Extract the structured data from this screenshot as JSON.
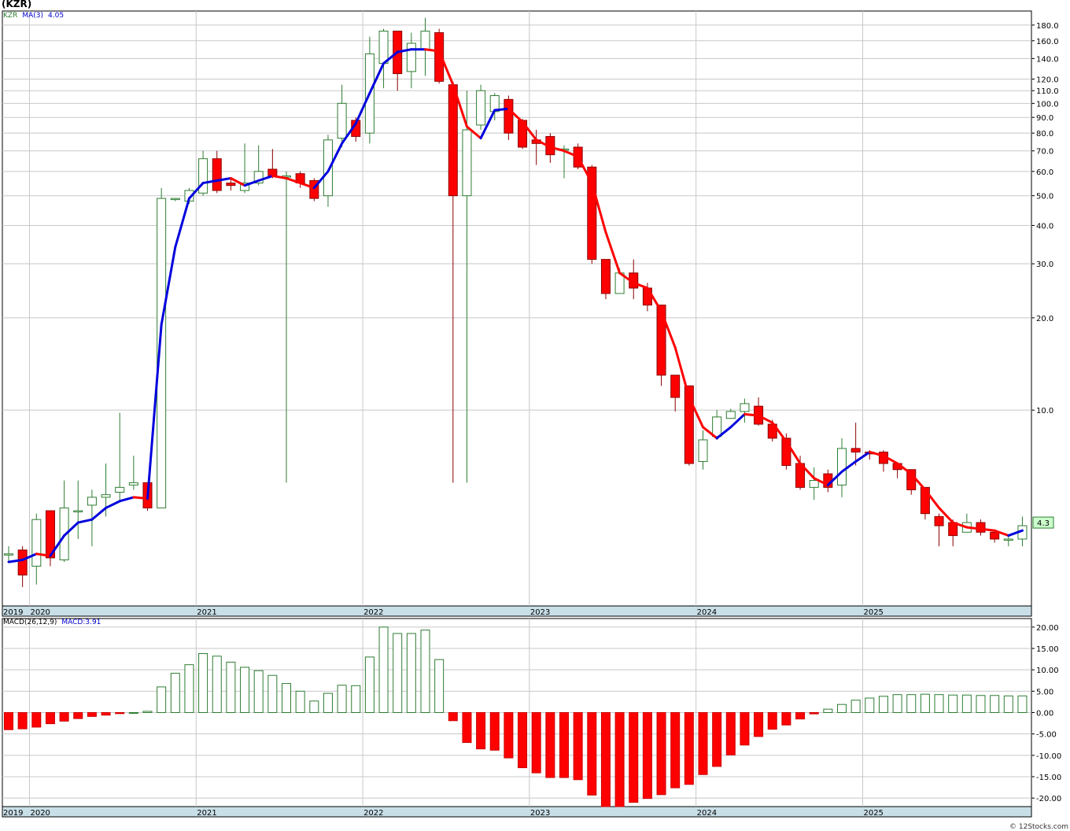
{
  "title": "(KZR)",
  "legend_price": {
    "symbol": "KZR",
    "ma_label": "MA(3)",
    "ma_value": "4.05"
  },
  "legend_macd": {
    "label": "MACD(26,12,9)",
    "value": "MACD:3.91"
  },
  "last_price_tag": "4.3",
  "credit": "© 12Stocks.com",
  "colors": {
    "up": "#2e7d32",
    "down": "#ff0000",
    "ma_up": "#0000dd",
    "ma_down": "#ff0000",
    "grid": "#c8c8c8",
    "band": "#c9dfe8"
  },
  "chart_data": [
    {
      "type": "candlestick",
      "title": "(KZR)",
      "y_scale": "log",
      "ylim": [
        2.3,
        200
      ],
      "x_unit": "month index (Nov 2019 = 0)",
      "year_labels": [
        "2019",
        "2020",
        "2021",
        "2022",
        "2023",
        "2024",
        "2025"
      ],
      "y_ticks": [
        {
          "v": 180,
          "label": "180.0"
        },
        {
          "v": 160,
          "label": "160.0"
        },
        {
          "v": 140,
          "label": "140.0"
        },
        {
          "v": 120,
          "label": "120.0"
        },
        {
          "v": 110,
          "label": "110.0"
        },
        {
          "v": 100,
          "label": "100.0"
        },
        {
          "v": 90,
          "label": "90.0"
        },
        {
          "v": 80,
          "label": "80.0"
        },
        {
          "v": 70,
          "label": "70.0"
        },
        {
          "v": 60,
          "label": "60.0"
        },
        {
          "v": 50,
          "label": "50.0"
        },
        {
          "v": 40,
          "label": "40.0"
        },
        {
          "v": 30,
          "label": "30.0"
        },
        {
          "v": 20,
          "label": "20.0"
        },
        {
          "v": 10,
          "label": "10.0"
        }
      ],
      "candles": [
        [
          3.4,
          3.4,
          3.6,
          3.2
        ],
        [
          3.5,
          2.9,
          3.6,
          2.65
        ],
        [
          3.1,
          4.4,
          4.6,
          2.7
        ],
        [
          4.7,
          3.3,
          4.6,
          3.1
        ],
        [
          3.25,
          4.8,
          5.9,
          3.2
        ],
        [
          4.7,
          4.7,
          5.9,
          3.8
        ],
        [
          4.9,
          5.2,
          5.5,
          3.6
        ],
        [
          5.2,
          5.3,
          6.7,
          4.5
        ],
        [
          5.4,
          5.6,
          9.8,
          5.1
        ],
        [
          5.7,
          5.8,
          7.1,
          5.5
        ],
        [
          5.8,
          4.8,
          5.8,
          4.7
        ],
        [
          4.8,
          49,
          53,
          4.8
        ],
        [
          49,
          49,
          49,
          48
        ],
        [
          48,
          52,
          53,
          47
        ],
        [
          51,
          66,
          70,
          50
        ],
        [
          66,
          52,
          70,
          51
        ],
        [
          55,
          54,
          57,
          52
        ],
        [
          52,
          55,
          74,
          51
        ],
        [
          55,
          60,
          73,
          54
        ],
        [
          61,
          58,
          71,
          57
        ],
        [
          58,
          58,
          60,
          5.8
        ],
        [
          59,
          55,
          60,
          53
        ],
        [
          56,
          49,
          57,
          48
        ],
        [
          50,
          76,
          79,
          46
        ],
        [
          77,
          100,
          115,
          72
        ],
        [
          88,
          78,
          90,
          75
        ],
        [
          80,
          145,
          165,
          74
        ],
        [
          135,
          172,
          175,
          112
        ],
        [
          172,
          125,
          172,
          110
        ],
        [
          127,
          157,
          170,
          112
        ],
        [
          150,
          172,
          190,
          123
        ],
        [
          170,
          118,
          175,
          116
        ],
        [
          115,
          50,
          118,
          5.8
        ],
        [
          50,
          82,
          110,
          5.8
        ],
        [
          85,
          110,
          115,
          82
        ],
        [
          94,
          106,
          108,
          88
        ],
        [
          103,
          80,
          106,
          76
        ],
        [
          88,
          72,
          89,
          71
        ],
        [
          76,
          74,
          82,
          63
        ],
        [
          78,
          68,
          80,
          64
        ],
        [
          71,
          71,
          73,
          57
        ],
        [
          72,
          62,
          74,
          61
        ],
        [
          62,
          31,
          63,
          30
        ],
        [
          31,
          24,
          31,
          23
        ],
        [
          24,
          28,
          29,
          24
        ],
        [
          28,
          25,
          31,
          23
        ],
        [
          25,
          22,
          26,
          21
        ],
        [
          22,
          13,
          22,
          12
        ],
        [
          13,
          11,
          13,
          9.9
        ],
        [
          12,
          6.7,
          12,
          6.6
        ],
        [
          6.8,
          8,
          8.6,
          6.4
        ],
        [
          8.2,
          9.5,
          10,
          8
        ],
        [
          9.4,
          9.9,
          10.1,
          9.4
        ],
        [
          9.9,
          10.5,
          10.9,
          9.1
        ],
        [
          10.3,
          9,
          11,
          8.9
        ],
        [
          9,
          8.1,
          9.3,
          7.9
        ],
        [
          8.1,
          6.6,
          8.4,
          6.4
        ],
        [
          6.7,
          5.6,
          7.1,
          5.5
        ],
        [
          5.6,
          5.9,
          6.5,
          5.1
        ],
        [
          6.2,
          5.6,
          6.4,
          5.4
        ],
        [
          5.7,
          7.5,
          8.1,
          5.2
        ],
        [
          7.5,
          7.3,
          9.1,
          6.6
        ],
        [
          7.3,
          7.2,
          7.4,
          6.9
        ],
        [
          7.3,
          6.7,
          7.4,
          6.3
        ],
        [
          6.7,
          6.4,
          6.7,
          6.0
        ],
        [
          6.4,
          5.5,
          6.4,
          5.3
        ],
        [
          5.6,
          4.6,
          5.6,
          4.4
        ],
        [
          4.5,
          4.2,
          4.6,
          3.6
        ],
        [
          4.3,
          3.9,
          4.4,
          3.6
        ],
        [
          4.0,
          4.3,
          4.6,
          4.0
        ],
        [
          4.3,
          4.0,
          4.4,
          3.9
        ],
        [
          4.0,
          3.8,
          4.0,
          3.7
        ],
        [
          3.8,
          3.8,
          3.9,
          3.6
        ],
        [
          3.8,
          4.2,
          4.5,
          3.6
        ]
      ],
      "ma": [
        3.2,
        3.25,
        3.4,
        3.35,
        3.9,
        4.3,
        4.4,
        4.8,
        5.05,
        5.2,
        5.15,
        19,
        34,
        49,
        55,
        56,
        57,
        54,
        56,
        58,
        57,
        55,
        53,
        60,
        74,
        86,
        108,
        135,
        147,
        150,
        150,
        148,
        115,
        84,
        77,
        95,
        96,
        87,
        76,
        72,
        70,
        67,
        55,
        38,
        28,
        26,
        25,
        21,
        16,
        11,
        8.8,
        8.1,
        8.8,
        9.7,
        9.6,
        9.1,
        7.9,
        6.7,
        6.0,
        5.7,
        6.3,
        6.8,
        7.3,
        7.1,
        6.7,
        6.2,
        5.5,
        4.8,
        4.3,
        4.15,
        4.1,
        4.05,
        3.9,
        4.05
      ],
      "last_price": 4.3
    },
    {
      "type": "bar",
      "title": "MACD(26,12,9)",
      "ylim": [
        -22,
        22
      ],
      "y_ticks": [
        {
          "v": 20,
          "label": "20.00"
        },
        {
          "v": 15,
          "label": "15.00"
        },
        {
          "v": 10,
          "label": "10.00"
        },
        {
          "v": 5,
          "label": "5.00"
        },
        {
          "v": 0,
          "label": "0.00"
        },
        {
          "v": -5,
          "label": "-5.00"
        },
        {
          "v": -10,
          "label": "-10.00"
        },
        {
          "v": -15,
          "label": "-15.00"
        },
        {
          "v": -20,
          "label": "-20.00"
        }
      ],
      "values": [
        -4.0,
        -3.8,
        -3.4,
        -2.6,
        -2.0,
        -1.4,
        -0.9,
        -0.6,
        -0.25,
        0.0,
        0.3,
        6.0,
        9.2,
        11.2,
        13.8,
        13.2,
        11.8,
        10.6,
        9.8,
        8.7,
        6.8,
        5.0,
        2.7,
        4.5,
        6.4,
        6.3,
        13.0,
        20.0,
        18.5,
        18.5,
        19.3,
        12.4,
        -1.9,
        -7.0,
        -8.5,
        -8.8,
        -10.6,
        -12.9,
        -14.1,
        -15.2,
        -15.2,
        -15.7,
        -19.3,
        -22.0,
        -22.0,
        -21.0,
        -20.1,
        -19.2,
        -17.6,
        -16.8,
        -14.5,
        -12.6,
        -9.9,
        -7.6,
        -5.6,
        -3.9,
        -2.9,
        -1.5,
        -0.3,
        0.8,
        1.9,
        2.9,
        3.4,
        3.8,
        4.2,
        4.2,
        4.3,
        4.2,
        4.1,
        4.1,
        4.0,
        4.0,
        3.9,
        3.9
      ]
    }
  ]
}
